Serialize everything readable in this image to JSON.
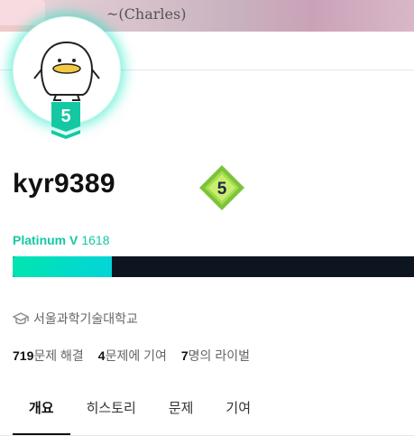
{
  "banner": {
    "scribble": "Charles"
  },
  "profile": {
    "username": "kyr9389",
    "tier_level": "5",
    "tier_name": "Platinum V",
    "rating": "1618",
    "rating_progress_fraction": 0.247,
    "school": "서울과학기술대학교"
  },
  "stats": {
    "solved_count": "719",
    "solved_label": "문제 해결",
    "contrib_count": "4",
    "contrib_label": "문제에 기여",
    "rival_count": "7",
    "rival_label": "명의 라이벌"
  },
  "tabs": [
    {
      "label": "개요",
      "active": true
    },
    {
      "label": "히스토리",
      "active": false
    },
    {
      "label": "문제",
      "active": false
    },
    {
      "label": "기여",
      "active": false
    }
  ],
  "colors": {
    "platinum": "#14c8a4",
    "progress_bg": "#0c1520",
    "diamond": "#7bc43a"
  },
  "icons": {
    "school": "graduation-cap-icon"
  }
}
